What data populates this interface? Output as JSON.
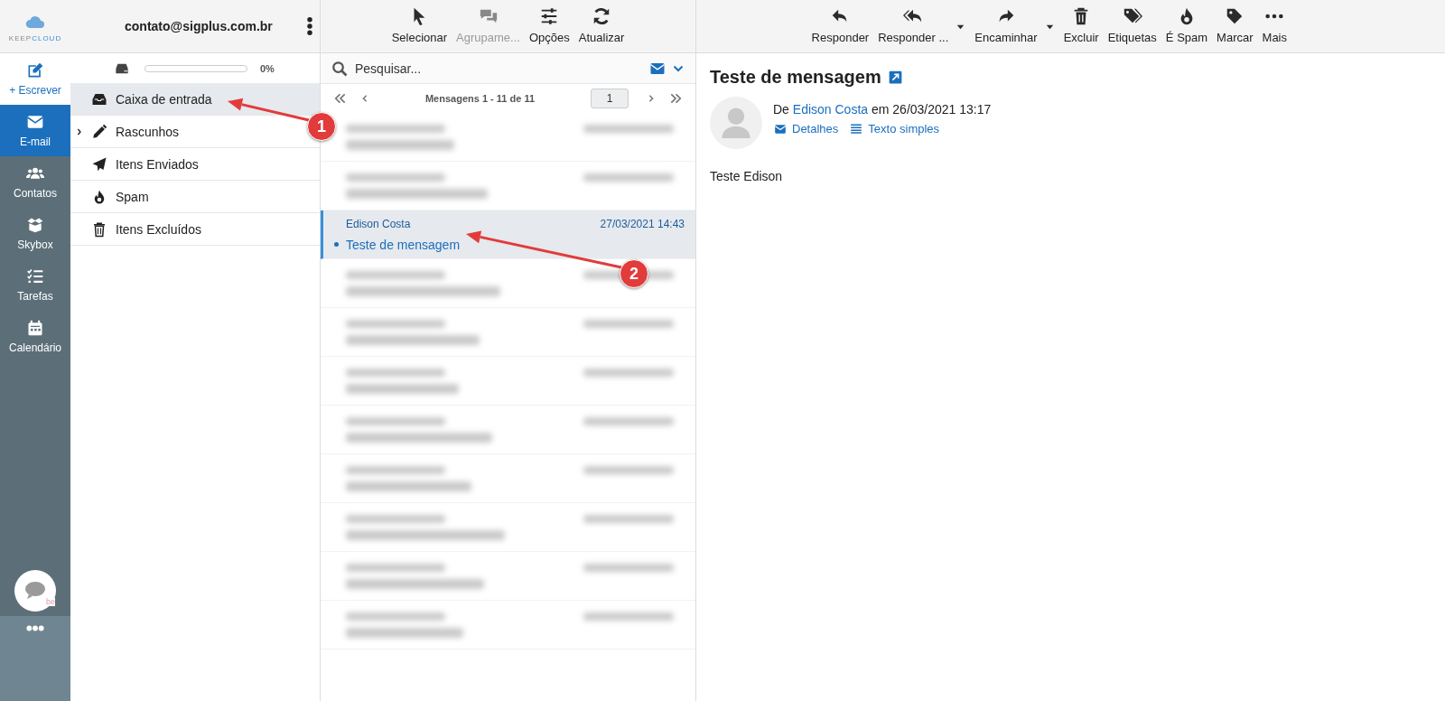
{
  "logo": {
    "text_1": "KEEP",
    "text_2": "CLOUD"
  },
  "account": {
    "email": "contato@sigplus.com.br"
  },
  "list_toolbar": [
    {
      "label": "Selecionar",
      "disabled": false
    },
    {
      "label": "Agrupame...",
      "disabled": true
    },
    {
      "label": "Opções",
      "disabled": false
    },
    {
      "label": "Atualizar",
      "disabled": false
    }
  ],
  "message_toolbar": [
    {
      "label": "Responder",
      "has_menu": false
    },
    {
      "label": "Responder ...",
      "has_menu": true
    },
    {
      "label": "Encaminhar",
      "has_menu": true
    },
    {
      "label": "Excluir",
      "has_menu": false
    },
    {
      "label": "Etiquetas",
      "has_menu": false
    },
    {
      "label": "É Spam",
      "has_menu": false
    },
    {
      "label": "Marcar",
      "has_menu": false
    },
    {
      "label": "Mais",
      "has_menu": false
    }
  ],
  "nav": [
    {
      "kind": "compose",
      "label": "+ Escrever",
      "selected": false
    },
    {
      "kind": "item",
      "label": "E-mail",
      "selected": true
    },
    {
      "kind": "item",
      "label": "Contatos",
      "selected": false
    },
    {
      "kind": "item",
      "label": "Skybox",
      "selected": false
    },
    {
      "kind": "item",
      "label": "Tarefas",
      "selected": false
    },
    {
      "kind": "item",
      "label": "Calendário",
      "selected": false
    }
  ],
  "chat_widget": {
    "mark": "be"
  },
  "storage": {
    "level": 0,
    "reading": "0%"
  },
  "folders": [
    {
      "label": "Caixa de entrada",
      "selected": true,
      "expandable": false
    },
    {
      "label": "Rascunhos",
      "selected": false,
      "expandable": true
    },
    {
      "label": "Itens Enviados",
      "selected": false,
      "expandable": false
    },
    {
      "label": "Spam",
      "selected": false,
      "expandable": false
    },
    {
      "label": "Itens Excluídos",
      "selected": false,
      "expandable": false
    }
  ],
  "search": {
    "placeholder": "Pesquisar..."
  },
  "pagination": {
    "summary": "Mensagens 1 - 11 de 11",
    "page": "1"
  },
  "messages": [
    {
      "kind": "blurred"
    },
    {
      "kind": "blurred"
    },
    {
      "kind": "message",
      "sender": "Edison Costa",
      "date": "27/03/2021 14:43",
      "subject": "Teste de mensagem",
      "selected": true,
      "unread": true
    },
    {
      "kind": "blurred"
    },
    {
      "kind": "blurred"
    },
    {
      "kind": "blurred"
    },
    {
      "kind": "blurred"
    },
    {
      "kind": "blurred"
    },
    {
      "kind": "blurred"
    },
    {
      "kind": "blurred"
    },
    {
      "kind": "blurred"
    }
  ],
  "message": {
    "subject": "Teste de mensagem",
    "from_prefix": "De",
    "sender": "Edison Costa",
    "date_text": "em 26/03/2021 13:17",
    "links": [
      "Detalhes",
      "Texto simples"
    ],
    "body": "Teste Edison"
  },
  "annotations": [
    {
      "number": "1"
    },
    {
      "number": "2"
    }
  ]
}
